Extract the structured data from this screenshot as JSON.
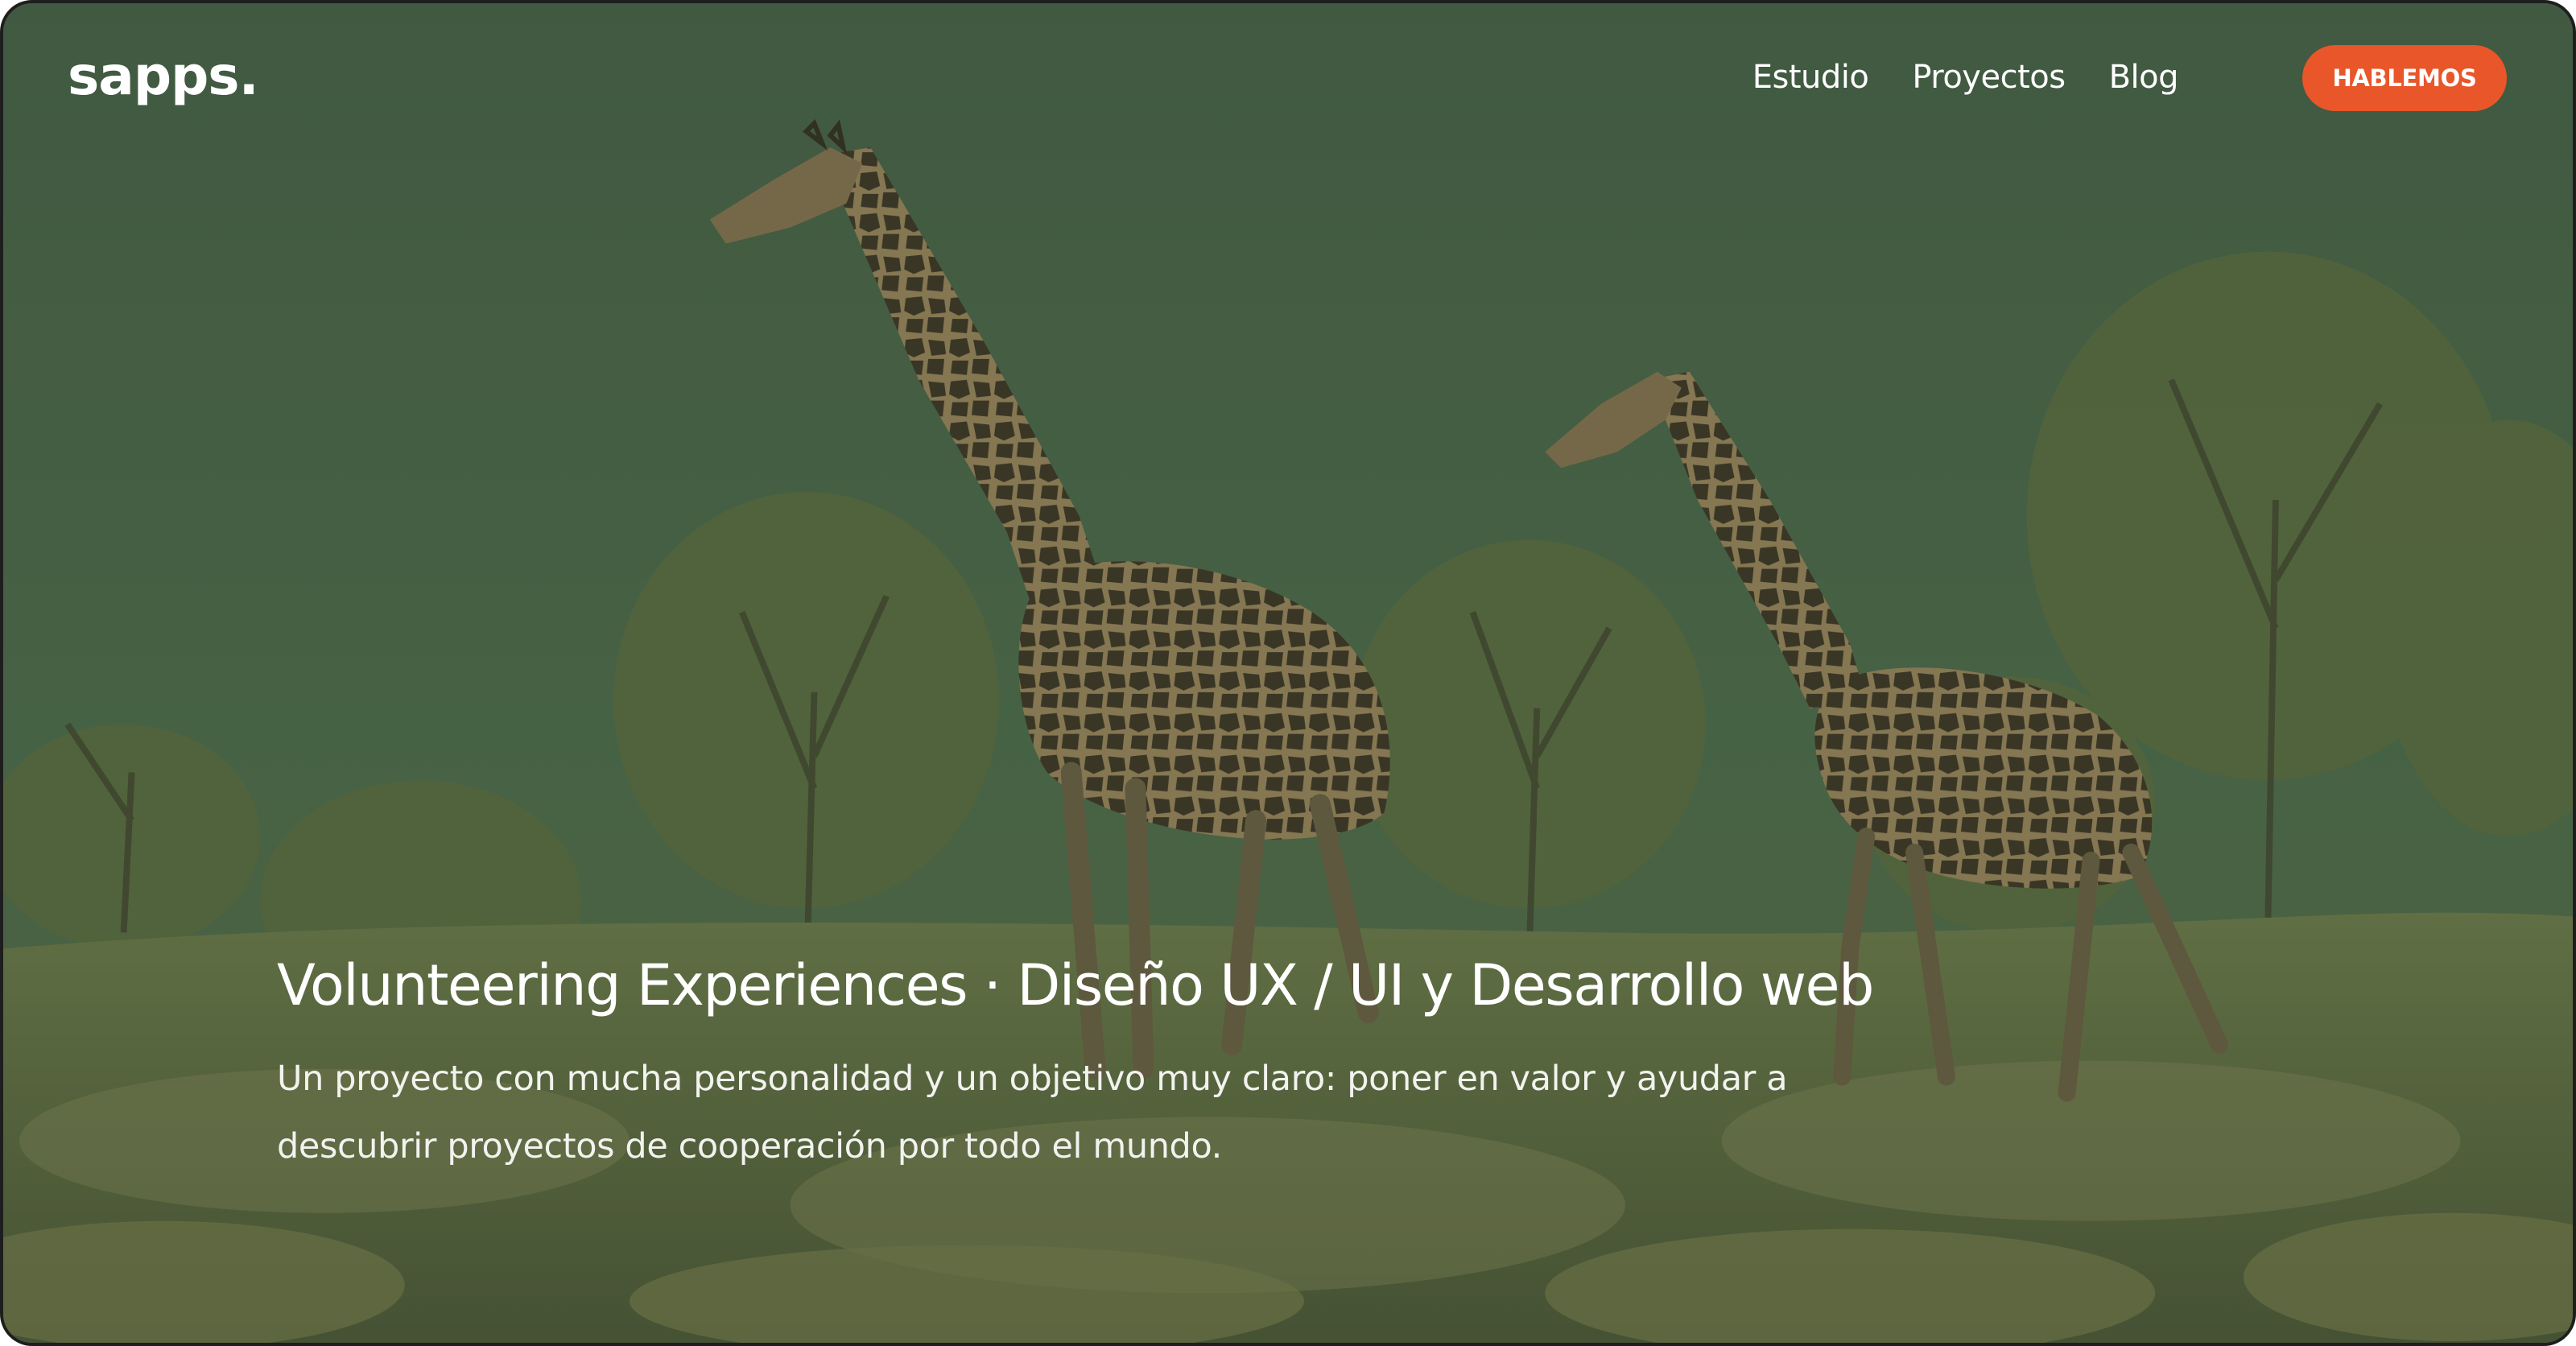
{
  "brand": {
    "logo_text": "sapps."
  },
  "nav": {
    "items": [
      {
        "label": "Estudio"
      },
      {
        "label": "Proyectos"
      },
      {
        "label": "Blog"
      }
    ],
    "cta_label": "HABLEMOS"
  },
  "hero": {
    "title": "Volunteering Experiences · Diseño UX / UI y Desarrollo web",
    "description": "Un proyecto con mucha personalidad y un objetivo muy claro: poner en valor y ayudar a descubrir proyectos de cooperación por todo el mundo."
  },
  "colors": {
    "overlay_green": "#4a5f45",
    "cta_orange": "#e8562a",
    "text": "#ffffff"
  }
}
